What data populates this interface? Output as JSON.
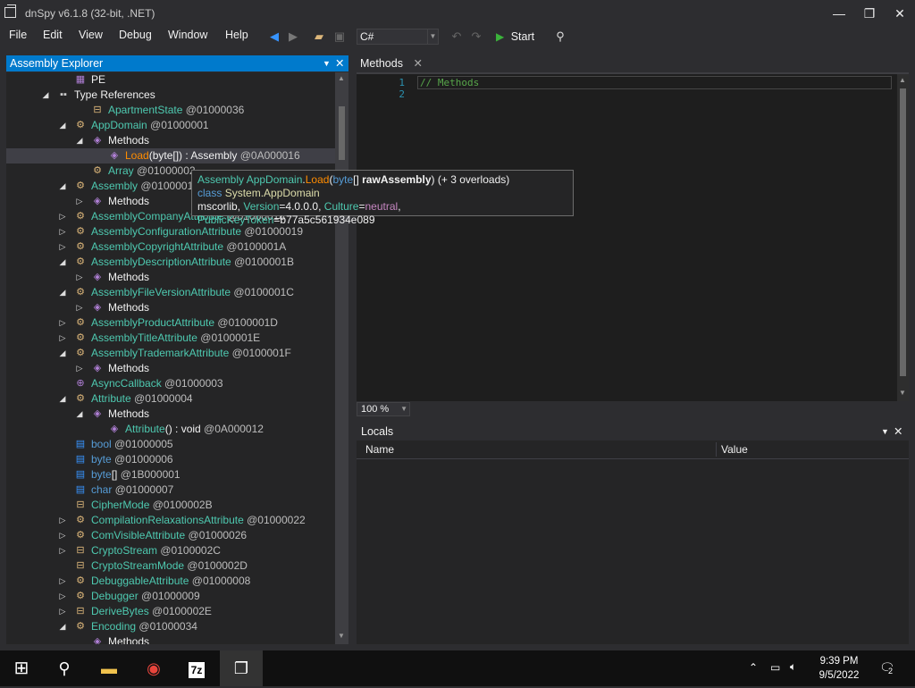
{
  "window": {
    "title": "dnSpy v6.1.8 (32-bit, .NET)"
  },
  "menu": [
    "File",
    "Edit",
    "View",
    "Debug",
    "Window",
    "Help"
  ],
  "toolbar": {
    "language": "C#",
    "start_label": "Start"
  },
  "assembly_explorer": {
    "title": "Assembly Explorer",
    "rows": [
      {
        "indent": 2,
        "exp": "",
        "icon": "pe",
        "label": "PE",
        "cls": "wh"
      },
      {
        "indent": 1,
        "exp": "◢",
        "icon": "typeref",
        "label": "Type References",
        "cls": "wh"
      },
      {
        "indent": 3,
        "exp": "",
        "icon": "enum",
        "name": "ApartmentState",
        "token": "@01000036",
        "cls": "t"
      },
      {
        "indent": 2,
        "exp": "◢",
        "icon": "class",
        "name": "AppDomain",
        "token": "@01000001",
        "cls": "t"
      },
      {
        "indent": 3,
        "exp": "◢",
        "icon": "method",
        "name": "Methods",
        "cls": "wh"
      },
      {
        "indent": 4,
        "exp": "",
        "icon": "method",
        "name": "Load",
        "sig": "(byte[]) : Assembly",
        "token": "@0A000016",
        "cls": "or",
        "selected": true
      },
      {
        "indent": 3,
        "exp": "",
        "icon": "class",
        "name": "Array",
        "token": "@01000002",
        "cls": "t"
      },
      {
        "indent": 2,
        "exp": "◢",
        "icon": "class",
        "name": "Assembly",
        "token": "@01000011",
        "cls": "t"
      },
      {
        "indent": 3,
        "exp": "▷",
        "icon": "method",
        "name": "Methods",
        "cls": "wh"
      },
      {
        "indent": 2,
        "exp": "▷",
        "icon": "class",
        "name": "AssemblyCompanyAttribute",
        "token": "@01000018",
        "cls": "t"
      },
      {
        "indent": 2,
        "exp": "▷",
        "icon": "class",
        "name": "AssemblyConfigurationAttribute",
        "token": "@01000019",
        "cls": "t"
      },
      {
        "indent": 2,
        "exp": "▷",
        "icon": "class",
        "name": "AssemblyCopyrightAttribute",
        "token": "@0100001A",
        "cls": "t"
      },
      {
        "indent": 2,
        "exp": "◢",
        "icon": "class",
        "name": "AssemblyDescriptionAttribute",
        "token": "@0100001B",
        "cls": "t"
      },
      {
        "indent": 3,
        "exp": "▷",
        "icon": "method",
        "name": "Methods",
        "cls": "wh"
      },
      {
        "indent": 2,
        "exp": "◢",
        "icon": "class",
        "name": "AssemblyFileVersionAttribute",
        "token": "@0100001C",
        "cls": "t"
      },
      {
        "indent": 3,
        "exp": "▷",
        "icon": "method",
        "name": "Methods",
        "cls": "wh"
      },
      {
        "indent": 2,
        "exp": "▷",
        "icon": "class",
        "name": "AssemblyProductAttribute",
        "token": "@0100001D",
        "cls": "t"
      },
      {
        "indent": 2,
        "exp": "▷",
        "icon": "class",
        "name": "AssemblyTitleAttribute",
        "token": "@0100001E",
        "cls": "t"
      },
      {
        "indent": 2,
        "exp": "◢",
        "icon": "class",
        "name": "AssemblyTrademarkAttribute",
        "token": "@0100001F",
        "cls": "t"
      },
      {
        "indent": 3,
        "exp": "▷",
        "icon": "method",
        "name": "Methods",
        "cls": "wh"
      },
      {
        "indent": 2,
        "exp": "",
        "icon": "delegate",
        "name": "AsyncCallback",
        "token": "@01000003",
        "cls": "t"
      },
      {
        "indent": 2,
        "exp": "◢",
        "icon": "class",
        "name": "Attribute",
        "token": "@01000004",
        "cls": "t"
      },
      {
        "indent": 3,
        "exp": "◢",
        "icon": "method",
        "name": "Methods",
        "cls": "wh"
      },
      {
        "indent": 4,
        "exp": "",
        "icon": "ctor",
        "name": "Attribute",
        "sig": "() : void",
        "token": "@0A000012",
        "cls": "t"
      },
      {
        "indent": 2,
        "exp": "",
        "icon": "struct",
        "name": "bool",
        "token": "@01000005",
        "cls": "kw"
      },
      {
        "indent": 2,
        "exp": "",
        "icon": "struct",
        "name": "byte",
        "token": "@01000006",
        "cls": "kw"
      },
      {
        "indent": 2,
        "exp": "",
        "icon": "struct",
        "name": "byte",
        "sig2": "[]",
        "token": "@1B000001",
        "cls": "kw"
      },
      {
        "indent": 2,
        "exp": "",
        "icon": "struct",
        "name": "char",
        "token": "@01000007",
        "cls": "kw"
      },
      {
        "indent": 2,
        "exp": "",
        "icon": "enum",
        "name": "CipherMode",
        "token": "@0100002B",
        "cls": "t"
      },
      {
        "indent": 2,
        "exp": "▷",
        "icon": "class",
        "name": "CompilationRelaxationsAttribute",
        "token": "@01000022",
        "cls": "t"
      },
      {
        "indent": 2,
        "exp": "▷",
        "icon": "class",
        "name": "ComVisibleAttribute",
        "token": "@01000026",
        "cls": "t"
      },
      {
        "indent": 2,
        "exp": "▷",
        "icon": "enum",
        "name": "CryptoStream",
        "token": "@0100002C",
        "cls": "t"
      },
      {
        "indent": 2,
        "exp": "",
        "icon": "enum",
        "name": "CryptoStreamMode",
        "token": "@0100002D",
        "cls": "t"
      },
      {
        "indent": 2,
        "exp": "▷",
        "icon": "class",
        "name": "DebuggableAttribute",
        "token": "@01000008",
        "cls": "t"
      },
      {
        "indent": 2,
        "exp": "▷",
        "icon": "class",
        "name": "Debugger",
        "token": "@01000009",
        "cls": "t"
      },
      {
        "indent": 2,
        "exp": "▷",
        "icon": "enum",
        "name": "DeriveBytes",
        "token": "@0100002E",
        "cls": "t"
      },
      {
        "indent": 2,
        "exp": "◢",
        "icon": "class",
        "name": "Encoding",
        "token": "@01000034",
        "cls": "t"
      },
      {
        "indent": 3,
        "exp": "",
        "icon": "method",
        "name": "Methods",
        "cls": "wh"
      }
    ]
  },
  "tooltip": {
    "line1_ret": "Assembly",
    "line1_type": "AppDomain",
    "line1_method": "Load",
    "line1_ptype": "byte",
    "line1_pname": "rawAssembly",
    "line1_overloads": "(+ 3 overloads)",
    "line2_kw": "class",
    "line2_name": "System.AppDomain",
    "line3_asm": "mscorlib,",
    "line3_ver_k": "Version",
    "line3_ver_v": "=4.0.0.0,",
    "line3_cul_k": "Culture",
    "line3_cul_v": "neutral",
    "line3_pk_k": "PublicKeyToken",
    "line3_pk_v": "=b77a5c561934e089"
  },
  "editor": {
    "tab": "Methods",
    "lines": [
      "1",
      "2"
    ],
    "code": "// Methods",
    "zoom": "100 %"
  },
  "locals": {
    "title": "Locals",
    "col_name": "Name",
    "col_value": "Value"
  },
  "taskbar": {
    "time": "9:39 PM",
    "date": "9/5/2022",
    "notif_count": "2"
  }
}
